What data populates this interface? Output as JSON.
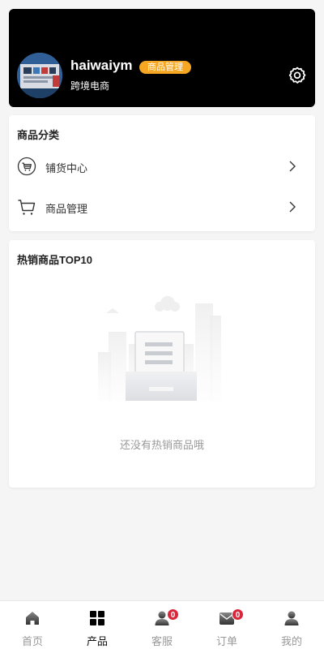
{
  "profile": {
    "username": "haiwaiym",
    "role_badge": "商品管理",
    "company": "跨境电商",
    "settings_icon": "settings-gear-icon"
  },
  "category": {
    "title": "商品分类",
    "items": [
      {
        "label": "铺货中心",
        "icon": "cart-circle-icon"
      },
      {
        "label": "商品管理",
        "icon": "shopping-cart-icon"
      }
    ]
  },
  "hot_products": {
    "title": "热销商品TOP10",
    "empty_text": "还没有热销商品哦"
  },
  "tabs": [
    {
      "label": "首页",
      "icon": "home-icon",
      "active": false,
      "badge": ""
    },
    {
      "label": "产品",
      "icon": "grid-icon",
      "active": true,
      "badge": ""
    },
    {
      "label": "客服",
      "icon": "customer-service-icon",
      "active": false,
      "badge": "0"
    },
    {
      "label": "订单",
      "icon": "order-mail-icon",
      "active": false,
      "badge": "0"
    },
    {
      "label": "我的",
      "icon": "user-icon",
      "active": false,
      "badge": ""
    }
  ],
  "colors": {
    "badge_orange": "#f5a623",
    "notification_red": "#d9263b",
    "header_bg": "#000000"
  }
}
